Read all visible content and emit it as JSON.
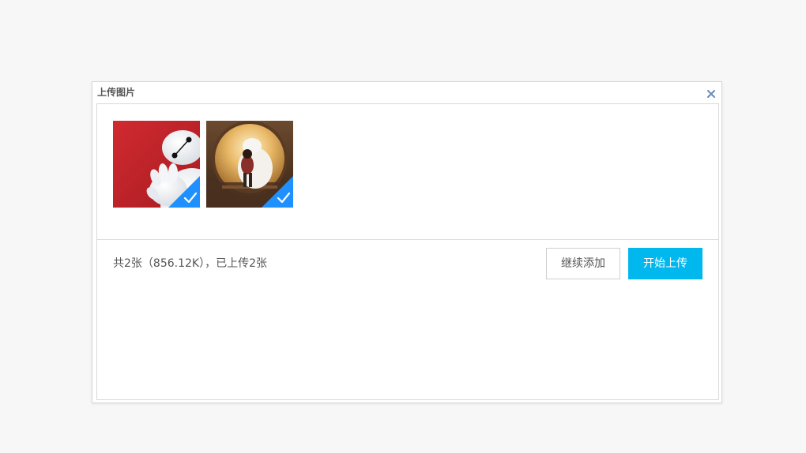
{
  "dialog": {
    "title": "上传图片",
    "close_icon": "close-icon"
  },
  "queue": {
    "items": [
      {
        "image": "baymax-waving-red-background",
        "status_icon": "check-icon",
        "status_color": "#1e90ff"
      },
      {
        "image": "baymax-hugging-in-round-window",
        "status_icon": "check-icon",
        "status_color": "#1e90ff"
      }
    ]
  },
  "footer": {
    "info": "共2张（856.12K），已上传2张",
    "add_more_label": "继续添加",
    "start_upload_label": "开始上传"
  },
  "colors": {
    "accent": "#00b7ee",
    "check_badge": "#1e90ff",
    "close_icon": "#6a8bbf"
  }
}
